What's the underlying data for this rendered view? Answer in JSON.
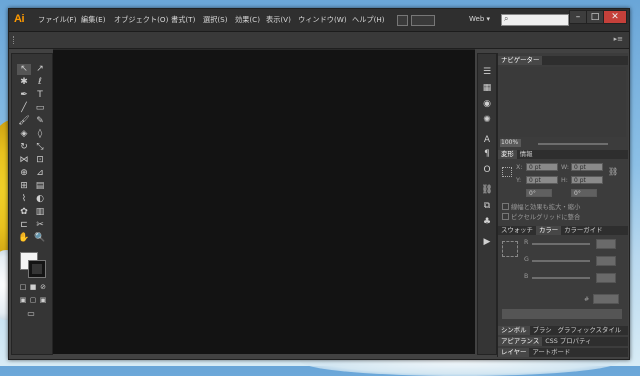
{
  "app": {
    "logo": "Ai"
  },
  "menu": [
    {
      "label": "ファイル(F)"
    },
    {
      "label": "編集(E)"
    },
    {
      "label": "オブジェクト(O)"
    },
    {
      "label": "書式(T)"
    },
    {
      "label": "選択(S)"
    },
    {
      "label": "効果(C)"
    },
    {
      "label": "表示(V)"
    },
    {
      "label": "ウィンドウ(W)"
    },
    {
      "label": "ヘルプ(H)"
    }
  ],
  "workspace": {
    "label": "Web"
  },
  "window_controls": {
    "minimize": "–",
    "maximize": "□",
    "close": "✕"
  },
  "navigator": {
    "tab": "ナビゲーター",
    "zoom": "100%"
  },
  "transform": {
    "tabs": [
      "変形",
      "情報"
    ],
    "x_label": "X:",
    "x_value": "0 pt",
    "y_label": "Y:",
    "y_value": "0 pt",
    "w_label": "W:",
    "w_value": "0 pt",
    "h_label": "H:",
    "h_value": "0 pt",
    "rotate_value": "0°",
    "shear_value": "0°",
    "scale_option": "線幅と効果も拡大・縮小",
    "pixel_option": "ピクセルグリッドに整合"
  },
  "color": {
    "tabs": [
      "スウォッチ",
      "カラー",
      "カラーガイド"
    ],
    "r_label": "R",
    "g_label": "G",
    "b_label": "B",
    "hex_label": "#"
  },
  "bottom_panels": [
    {
      "tabs": [
        "シンボル",
        "ブラシ",
        "グラフィックスタイル"
      ]
    },
    {
      "tabs": [
        "アピアランス",
        "CSS プロパティ"
      ]
    },
    {
      "tabs": [
        "レイヤー",
        "アートボード"
      ]
    }
  ],
  "colors": {
    "accent": "#ff9a00",
    "canvas": "#131313",
    "ui": "#424242",
    "close": "#c5403a"
  }
}
